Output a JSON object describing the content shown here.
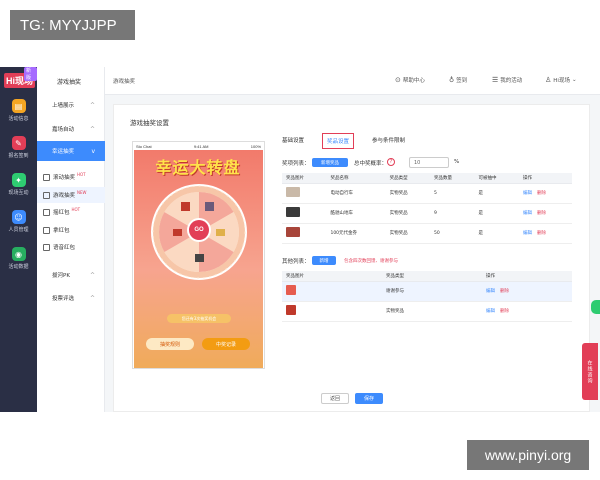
{
  "watermark_top": "TG: MYYJJPP",
  "watermark_bottom": "www.pinyi.org",
  "rail": {
    "logo": "Hi现场",
    "logo_badge": "新版",
    "items": [
      {
        "label": "活动信息",
        "icon": "info-icon",
        "color": "#f5a623"
      },
      {
        "label": "报名签到",
        "icon": "checkin-icon",
        "color": "#e23e57"
      },
      {
        "label": "现场互动",
        "icon": "interact-icon",
        "color": "#2ecc71"
      },
      {
        "label": "人员管理",
        "icon": "people-icon",
        "color": "#3d8bfd"
      },
      {
        "label": "活动数据",
        "icon": "data-icon",
        "color": "#27ae60"
      }
    ]
  },
  "menu": {
    "title": "游戏抽奖",
    "items": [
      {
        "label": "上墙展示",
        "chev": "^"
      },
      {
        "label": "嘉场自动",
        "chev": "^"
      },
      {
        "label": "幸运抽奖",
        "chev": "v"
      },
      {
        "label": "滚动抽奖",
        "hot": "HOT"
      },
      {
        "label": "游戏抽奖",
        "hot": "NEW"
      },
      {
        "label": "摇红包",
        "hot": "HOT"
      },
      {
        "label": "拿红包"
      },
      {
        "label": "语音红包"
      },
      {
        "label": "拔河PK",
        "chev": "^"
      },
      {
        "label": "投票评选",
        "chev": "^"
      }
    ]
  },
  "topbar": {
    "crumb": "游戏抽奖",
    "help": "帮助中心",
    "signin": "签到",
    "my_activity": "我的活动",
    "user": "Hi现场"
  },
  "card": {
    "title": "游戏抽奖设置",
    "tabs": [
      "基础设置",
      "奖品设置",
      "参与条件限制"
    ],
    "active_tab": 1
  },
  "phone": {
    "carrier": "Sto Chat",
    "time": "9:41 AM",
    "battery": "100%",
    "banner_title": "幸运大转盘",
    "go": "GO",
    "chances": "您还有3次抽奖机会",
    "btn_rules": "抽奖规则",
    "btn_records": "中奖记录"
  },
  "prizes": {
    "label": "奖项列表：",
    "add_btn": "新增奖品",
    "rate_label": "总中奖概率：",
    "rate_value": "10",
    "rate_unit": "%",
    "help_glyph": "?",
    "columns": [
      "奖品图片",
      "奖品名称",
      "奖品类型",
      "奖品数量",
      "可被抽中",
      "操作"
    ],
    "rows": [
      {
        "name": "电动自行车",
        "type": "实物奖品",
        "qty": "5",
        "can": "是",
        "edit": "编辑",
        "del": "删除",
        "thumb": "#c9b9a8"
      },
      {
        "name": "酷驰山地车",
        "type": "实物奖品",
        "qty": "9",
        "can": "是",
        "edit": "编辑",
        "del": "删除",
        "thumb": "#3a3a3a"
      },
      {
        "name": "100元代金券",
        "type": "实物奖品",
        "qty": "50",
        "can": "是",
        "edit": "编辑",
        "del": "删除",
        "thumb": "#a8453a"
      }
    ]
  },
  "others": {
    "label": "其他列表：",
    "add_btn": "新增",
    "hint": "包含四次数回馈、谢谢参与",
    "columns": [
      "奖品图片",
      "奖品类型",
      "操作"
    ],
    "rows": [
      {
        "type": "谢谢参与",
        "edit": "编辑",
        "del": "删除",
        "thumb": "#e65c4f"
      },
      {
        "type": "实物奖品",
        "edit": "编辑",
        "del": "删除",
        "thumb": "#c0392b"
      }
    ]
  },
  "footer": {
    "back": "返回",
    "save": "保存"
  },
  "float_tab": "在线咨询"
}
